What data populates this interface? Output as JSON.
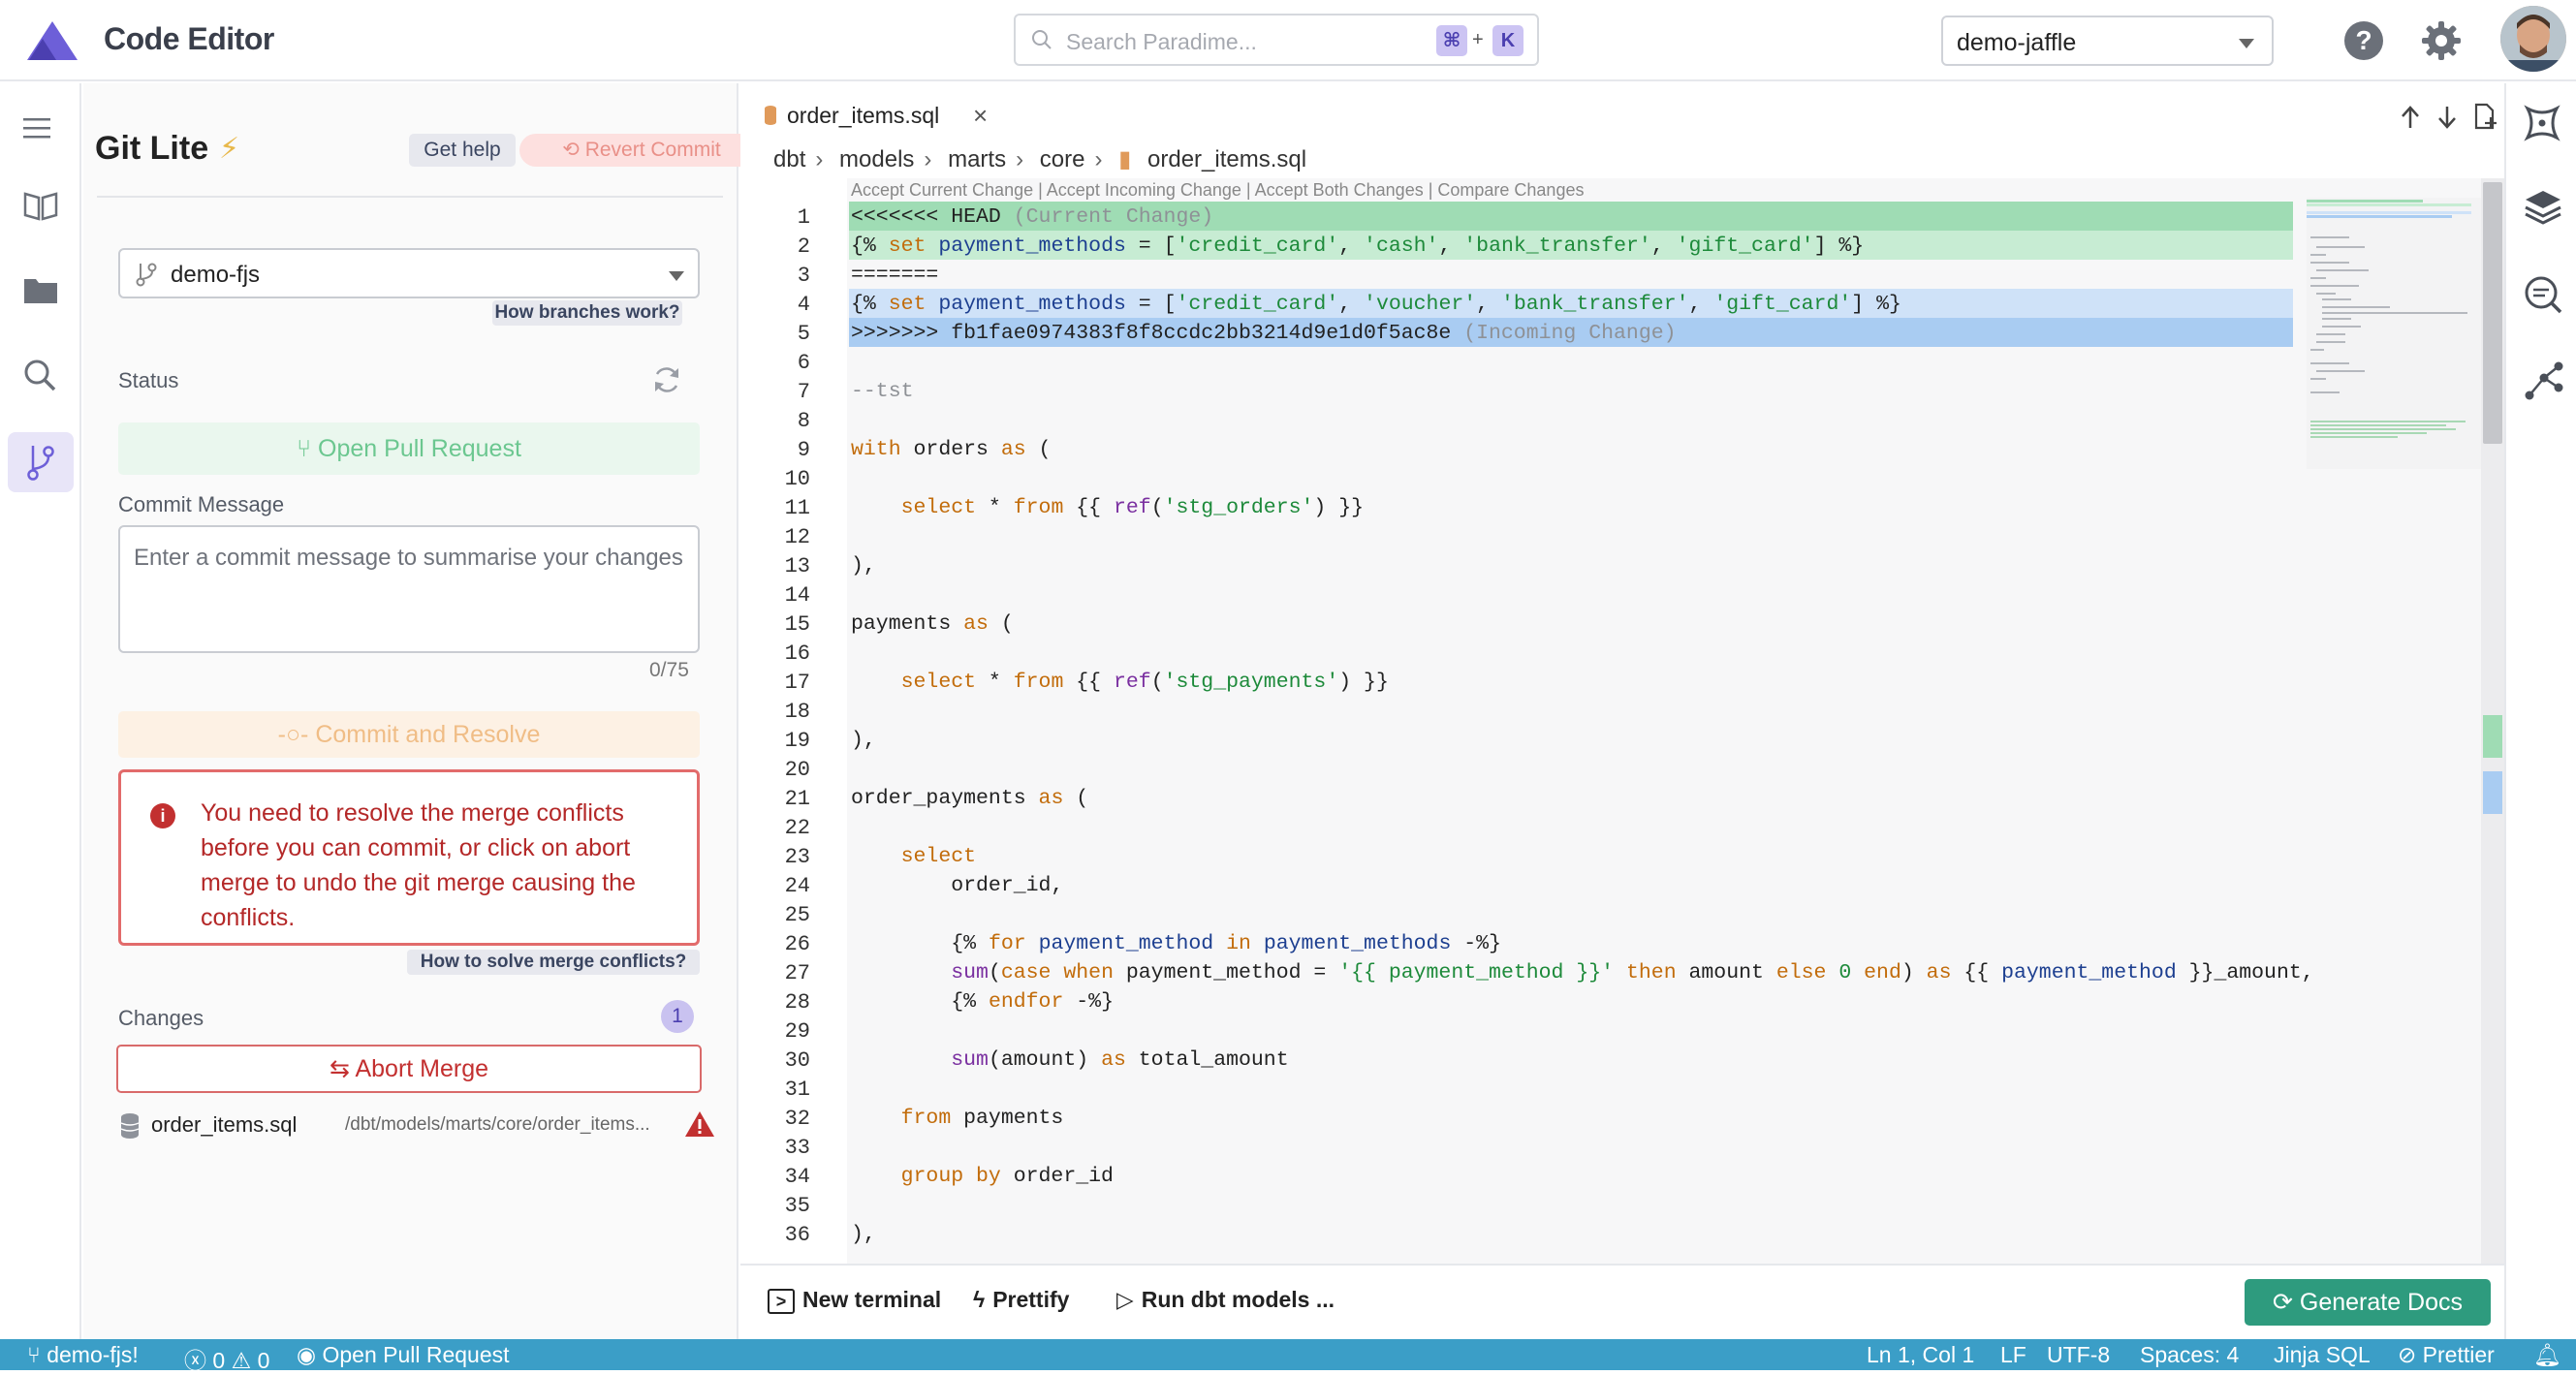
{
  "app": {
    "title": "Code Editor"
  },
  "search": {
    "placeholder": "Search Paradime...",
    "shortcut_key1": "⌘",
    "shortcut_plus": "+",
    "shortcut_key2": "K"
  },
  "project": {
    "selected": "demo-jaffle"
  },
  "header": {
    "help_glyph": "?"
  },
  "git_panel": {
    "title": "Git Lite",
    "get_help": "Get help",
    "revert_commit": "Revert Commit",
    "branch": "demo-fjs",
    "how_branches": "How branches work?",
    "status_label": "Status",
    "open_pr": "Open Pull Request",
    "commit_label": "Commit Message",
    "commit_placeholder": "Enter a commit message to summarise your changes",
    "commit_count": "0/75",
    "commit_resolve": "Commit and Resolve",
    "alert_text": "You need to resolve the merge conflicts before you can commit, or click on abort merge to undo the git merge causing the conflicts.",
    "how_conflicts": "How to solve merge conflicts?",
    "changes_label": "Changes",
    "changes_count": "1",
    "abort_merge": "Abort Merge",
    "changed_file": {
      "name": "order_items.sql",
      "path": "/dbt/models/marts/core/order_items..."
    }
  },
  "editor": {
    "tab": "order_items.sql",
    "breadcrumb": [
      "dbt",
      "models",
      "marts",
      "core",
      "order_items.sql"
    ],
    "codelens": "Accept Current Change | Accept Incoming Change | Accept Both Changes | Compare Changes",
    "line_numbers": [
      "1",
      "2",
      "3",
      "4",
      "5",
      "6",
      "7",
      "8",
      "9",
      "10",
      "11",
      "12",
      "13",
      "14",
      "15",
      "16",
      "17",
      "18",
      "19",
      "20",
      "21",
      "22",
      "23",
      "24",
      "25",
      "26",
      "27",
      "28",
      "29",
      "30",
      "31",
      "32",
      "33",
      "34",
      "35",
      "36"
    ]
  },
  "toolbar": {
    "new_terminal": "New terminal",
    "prettify": "Prettify",
    "run_models": "Run dbt models ...",
    "generate_docs": "Generate Docs"
  },
  "statusbar": {
    "branch": "demo-fjs!",
    "errors": "0",
    "warnings": "0",
    "open_pr": "Open Pull Request",
    "position": "Ln 1, Col 1",
    "eol": "LF",
    "encoding": "UTF-8",
    "spaces": "Spaces: 4",
    "language": "Jinja SQL",
    "formatter": "Prettier"
  },
  "colors": {
    "accent": "#6d5fd8",
    "status_bar": "#3b9ec7",
    "generate_docs": "#2e9b7e",
    "error": "#c33030"
  }
}
